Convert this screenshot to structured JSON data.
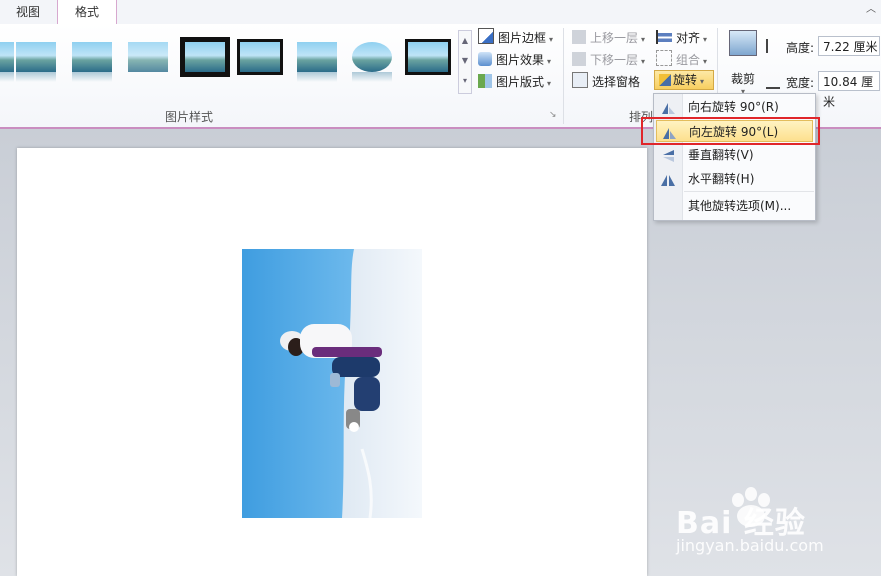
{
  "tabs": [
    {
      "label": "视图"
    },
    {
      "label": "格式"
    }
  ],
  "collapse_icon": "chevron-up-icon",
  "picture_styles": {
    "group_label": "图片样式",
    "styles_count_note": ""
  },
  "picture_tools": [
    {
      "label": "图片边框",
      "icon": "pen-border-icon"
    },
    {
      "label": "图片效果",
      "icon": "effects-icon"
    },
    {
      "label": "图片版式",
      "icon": "layout-icon"
    }
  ],
  "arrange": {
    "group_label": "排列",
    "bring_forward": "上移一层",
    "send_backward": "下移一层",
    "selection_pane": "选择窗格",
    "align": "对齐",
    "group": "组合",
    "rotate": "旋转"
  },
  "size": {
    "crop": "裁剪",
    "height_label": "高度:",
    "height_value": "7.22 厘米",
    "width_label": "宽度:",
    "width_value": "10.84 厘米"
  },
  "rotate_menu": {
    "items": [
      {
        "label": "向右旋转 90°(R)",
        "icon": "rotate-right-icon"
      },
      {
        "label": "向左旋转 90°(L)",
        "icon": "rotate-left-icon",
        "highlighted": true
      },
      {
        "label": "垂直翻转(V)",
        "icon": "flip-vertical-icon"
      },
      {
        "label": "水平翻转(H)",
        "icon": "flip-horizontal-icon"
      }
    ],
    "more": "其他旋转选项(M)..."
  },
  "watermark": {
    "brand": "Bai 经验",
    "url": "jingyan.baidu.com"
  },
  "colors": {
    "accent_tab_border": "#d7a8cf",
    "highlight_red": "#e0262a",
    "menu_highlight": "#fde08e"
  }
}
